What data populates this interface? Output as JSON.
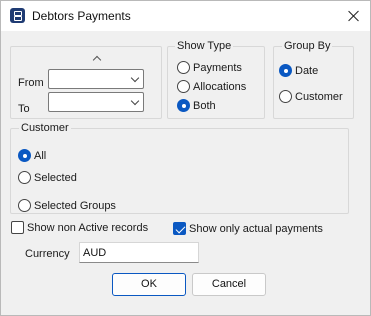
{
  "window": {
    "title": "Debtors Payments"
  },
  "date_range": {
    "from_label": "From",
    "to_label": "To",
    "from_value": "",
    "to_value": ""
  },
  "show_type": {
    "label": "Show Type",
    "options": [
      "Payments",
      "Allocations",
      "Both"
    ],
    "selected": "Both"
  },
  "group_by": {
    "label": "Group By",
    "options": [
      "Date",
      "Customer"
    ],
    "selected": "Date"
  },
  "customer": {
    "label": "Customer",
    "options": [
      "All",
      "Selected",
      "Selected Groups"
    ],
    "selected": "All"
  },
  "checkboxes": {
    "show_non_active": {
      "label": "Show non Active records",
      "checked": false
    },
    "show_only_actual": {
      "label": "Show only actual payments",
      "checked": true
    }
  },
  "currency": {
    "label": "Currency",
    "value": "AUD"
  },
  "buttons": {
    "ok": "OK",
    "cancel": "Cancel"
  },
  "colors": {
    "accent": "#0a58c2",
    "background": "#f0f0f0"
  }
}
